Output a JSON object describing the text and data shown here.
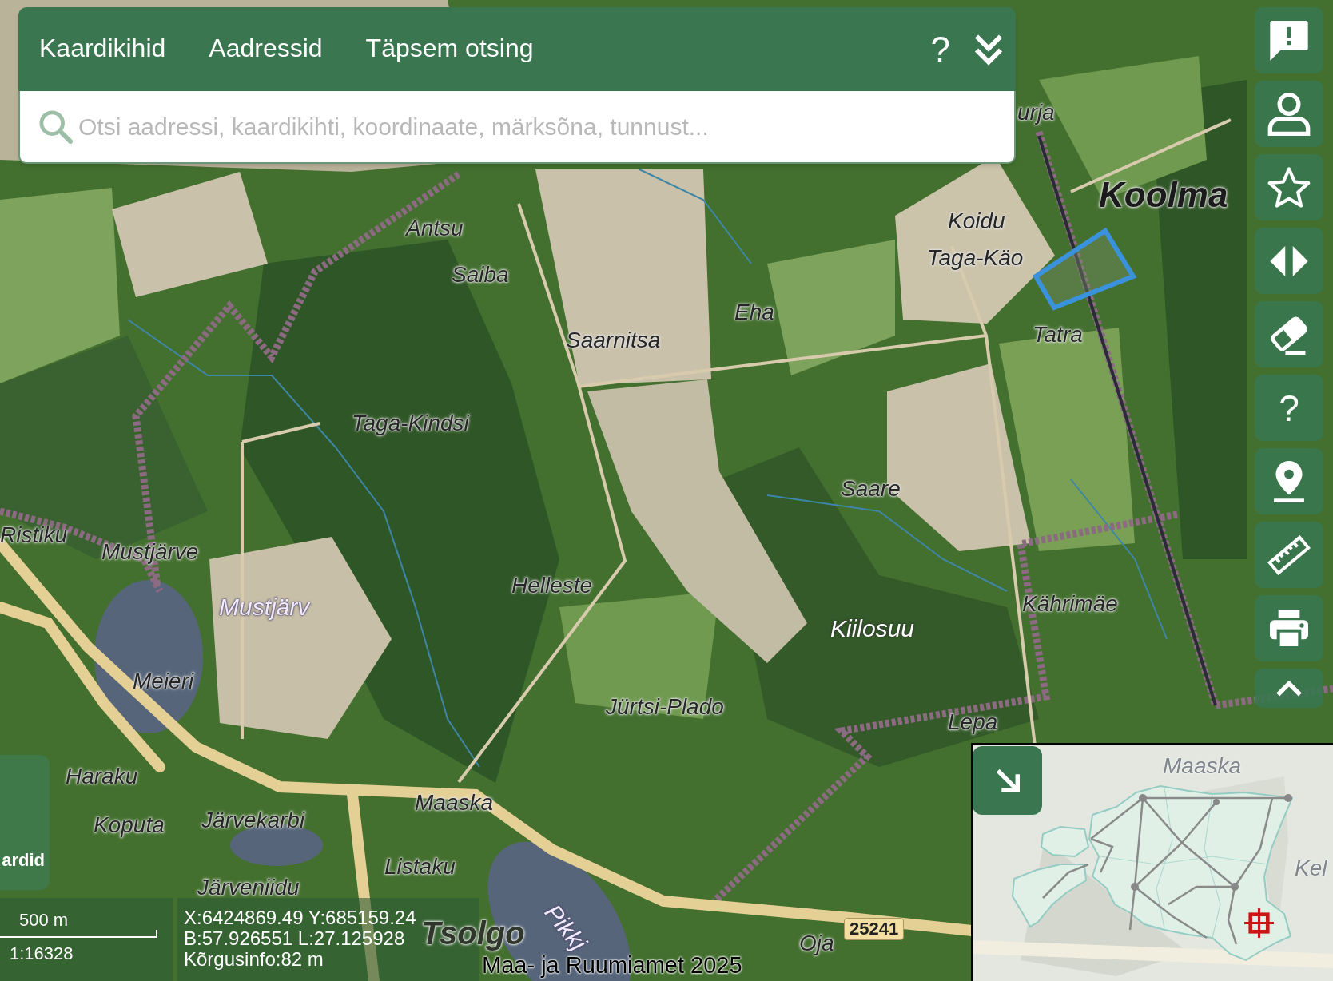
{
  "search_panel": {
    "tabs": [
      {
        "label": "Kaardikihid",
        "selected": false
      },
      {
        "label": "Aadressid",
        "selected": false
      },
      {
        "label": "Täpsem otsing",
        "selected": false
      }
    ],
    "help_label": "?",
    "search": {
      "placeholder": "Otsi aadressi, kaardikihti, koordinaate, märksõna, tunnust..."
    }
  },
  "toolbar": [
    {
      "kind": "feedback"
    },
    {
      "kind": "account"
    },
    {
      "kind": "favorites"
    },
    {
      "kind": "compare"
    },
    {
      "kind": "erase"
    },
    {
      "kind": "help",
      "label": "?"
    },
    {
      "kind": "location"
    },
    {
      "kind": "measure"
    },
    {
      "kind": "print"
    },
    {
      "kind": "collapse"
    }
  ],
  "map": {
    "labels": [
      {
        "text": "urja",
        "kind": "place"
      },
      {
        "text": "Koolma",
        "kind": "village"
      },
      {
        "text": "Koidu",
        "kind": "place"
      },
      {
        "text": "Antsu",
        "kind": "place"
      },
      {
        "text": "Taga-Käo",
        "kind": "place"
      },
      {
        "text": "Saiba",
        "kind": "place"
      },
      {
        "text": "Eha",
        "kind": "place"
      },
      {
        "text": "Tatra",
        "kind": "place"
      },
      {
        "text": "Saarnitsa",
        "kind": "place"
      },
      {
        "text": "Taga-Kindsi",
        "kind": "place"
      },
      {
        "text": "Saare",
        "kind": "place"
      },
      {
        "text": "Ristiku",
        "kind": "place"
      },
      {
        "text": "Mustjärve",
        "kind": "place"
      },
      {
        "text": "Helleste",
        "kind": "place"
      },
      {
        "text": "Kährimäe",
        "kind": "place"
      },
      {
        "text": "Mustjärv",
        "kind": "water"
      },
      {
        "text": "Kiilosuu",
        "kind": "nature"
      },
      {
        "text": "Meieri",
        "kind": "place"
      },
      {
        "text": "Jürtsi-Plado",
        "kind": "place"
      },
      {
        "text": "Lepa",
        "kind": "place"
      },
      {
        "text": "Haraku",
        "kind": "place"
      },
      {
        "text": "Maaska",
        "kind": "place"
      },
      {
        "text": "Järvekarbi",
        "kind": "place"
      },
      {
        "text": "Koputa",
        "kind": "place"
      },
      {
        "text": "Listaku",
        "kind": "place"
      },
      {
        "text": "Järveniidu",
        "kind": "place"
      },
      {
        "text": "25241",
        "kind": "road_number"
      },
      {
        "text": "Tsolgo",
        "kind": "town"
      },
      {
        "text": "Pikkj",
        "kind": "water"
      },
      {
        "text": "Oja",
        "kind": "place"
      }
    ]
  },
  "base_layer_button": {
    "label": "ardid"
  },
  "scale": {
    "distance": "500 m",
    "ratio": "1:16328"
  },
  "coordinates": {
    "lines": [
      "X:6424869.49 Y:685159.24",
      "B:57.926551 L:27.125928",
      "Kõrgusinfo:82 m"
    ]
  },
  "attribution": "Maa- ja Ruumiamet 2025",
  "overview_map": {
    "labels": [
      "Maaska",
      "Kel"
    ]
  }
}
